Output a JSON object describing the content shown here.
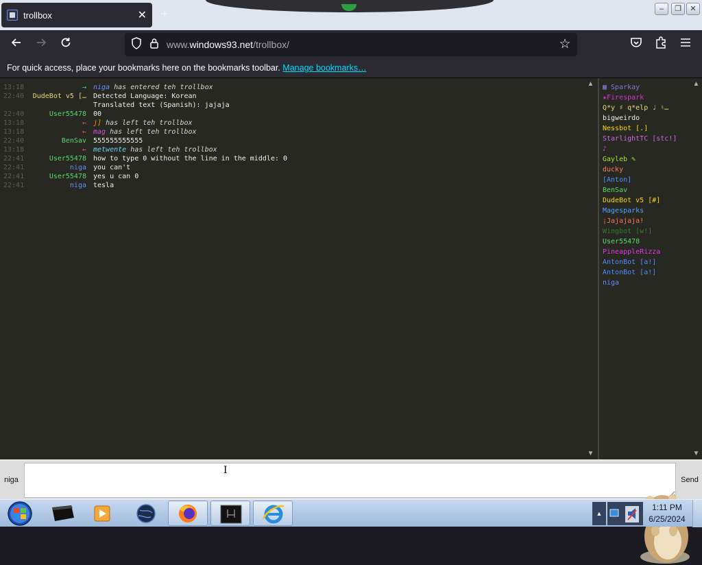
{
  "browser": {
    "tab_title": "trollbox",
    "new_tab": "+",
    "url_prefix": "www.",
    "url_host": "windows93.net",
    "url_path": "/trollbox/",
    "bookmarks_message": "For quick access, place your bookmarks here on the bookmarks toolbar.",
    "bookmarks_link": "Manage bookmarks…"
  },
  "messages": [
    {
      "time": "13:18",
      "nick": "→",
      "nick_color": "#5bd96a",
      "text": "has entered teh trollbox",
      "ref": "niga",
      "ref_color": "#6b8cff",
      "system": true
    },
    {
      "time": "22:40",
      "nick": "DudeBot v5 […",
      "nick_color": "#e6db74",
      "text": "Detected Language: Korean",
      "system": false
    },
    {
      "time": "",
      "nick": "",
      "nick_color": "#e6db74",
      "text": "Translated text (Spanish): jajaja",
      "system": false
    },
    {
      "time": "22:40",
      "nick": "User55478",
      "nick_color": "#5bd96a",
      "text": "00",
      "system": false
    },
    {
      "time": "13:18",
      "nick": "←",
      "nick_color": "#ff5555",
      "text": "has left teh trollbox",
      "ref": "j]",
      "ref_color": "#ff8c00",
      "system": true
    },
    {
      "time": "13:18",
      "nick": "←",
      "nick_color": "#ff5555",
      "text": "has left teh trollbox",
      "ref": "mag",
      "ref_color": "#d54fd5",
      "system": true
    },
    {
      "time": "22:40",
      "nick": "BenSav",
      "nick_color": "#5bd96a",
      "text": "555555555555",
      "system": false
    },
    {
      "time": "13:18",
      "nick": "←",
      "nick_color": "#ff5555",
      "text": "has left teh trollbox",
      "ref": "metwente",
      "ref_color": "#66d9ef",
      "system": true
    },
    {
      "time": "22:41",
      "nick": "User55478",
      "nick_color": "#5bd96a",
      "text": "how to type 0 without the line in the middle: 0",
      "system": false
    },
    {
      "time": "22:41",
      "nick": "niga",
      "nick_color": "#6b8cff",
      "text": "you can't",
      "system": false
    },
    {
      "time": "22:41",
      "nick": "User55478",
      "nick_color": "#5bd96a",
      "text": "yes u can 0",
      "system": false
    },
    {
      "time": "22:41",
      "nick": "niga",
      "nick_color": "#6b8cff",
      "text": "tesla",
      "system": false
    }
  ],
  "users": [
    {
      "name": "▦ Sparkay",
      "color": "#7d7ad6"
    },
    {
      "name": "★Firespark",
      "color": "#d433d4"
    },
    {
      "name": "Q*y ♯ q*elp ♩ ♮…",
      "color": "#e6db74"
    },
    {
      "name": "bigweirdo",
      "color": "#f0f0ea"
    },
    {
      "name": "Nessbot [.]",
      "color": "#ffd700"
    },
    {
      "name": "StarlightTC [stc!]",
      "color": "#c86ad8"
    },
    {
      "name": "♪",
      "color": "#b452c8"
    },
    {
      "name": "Gayleb ✎",
      "color": "#a6e22e"
    },
    {
      "name": "ducky",
      "color": "#ff7d5e"
    },
    {
      "name": "[Anton]",
      "color": "#4f8dff"
    },
    {
      "name": "BenSav",
      "color": "#5bd96a"
    },
    {
      "name": "DudeBot v5 [#]",
      "color": "#ffd700"
    },
    {
      "name": "Magesparks",
      "color": "#4fa3ff"
    },
    {
      "name": "¡Jajajaja!",
      "color": "#ff6f61"
    },
    {
      "name": "Wingbot [w!]",
      "color": "#2f7a2f"
    },
    {
      "name": "User55478",
      "color": "#5bd96a"
    },
    {
      "name": "PineappleRizza",
      "color": "#e03adf"
    },
    {
      "name": "AntonBot [a!]",
      "color": "#4f8dff"
    },
    {
      "name": "AntonBot [a!]",
      "color": "#4f8dff"
    },
    {
      "name": "niga",
      "color": "#6b8cff"
    }
  ],
  "sendbar": {
    "nick": "niga",
    "input_value": "",
    "send_label": "Send"
  },
  "taskbar": {
    "time": "1:11 PM",
    "date": "6/25/2024"
  }
}
